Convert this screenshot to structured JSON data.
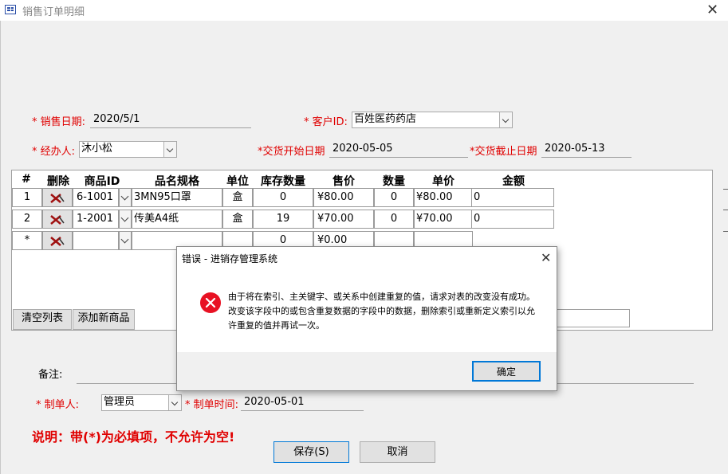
{
  "window": {
    "title": "销售订单明细"
  },
  "form": {
    "sale_date": {
      "label": "* 销售日期:",
      "value": "2020/5/1"
    },
    "customer_id": {
      "label": "* 客户ID:",
      "value": "百姓医药药店"
    },
    "handler": {
      "label": "* 经办人:",
      "value": "沐小松"
    },
    "delivery_start": {
      "label": "*交货开始日期",
      "value": "2020-05-05"
    },
    "delivery_end": {
      "label": "*交货截止日期",
      "value": "2020-05-13"
    },
    "remark": {
      "label": "备注:",
      "value": ""
    },
    "creator": {
      "label": "* 制单人:",
      "value": "管理员"
    },
    "create_time": {
      "label": "* 制单时间:",
      "value": "2020-05-01"
    }
  },
  "grid": {
    "columns": [
      "#",
      "删除",
      "商品ID",
      "品名规格",
      "单位",
      "库存数量",
      "售价",
      "数量",
      "单价",
      "金额"
    ],
    "rows": [
      {
        "num": "1",
        "product_id": "6-1001",
        "name": "3MN95口罩",
        "unit": "盒",
        "stock": "0",
        "price": "¥80.00",
        "qty": "0",
        "unit_price": "¥80.00",
        "amount": "0"
      },
      {
        "num": "2",
        "product_id": "1-2001",
        "name": "传美A4纸",
        "unit": "盒",
        "stock": "19",
        "price": "¥70.00",
        "qty": "0",
        "unit_price": "¥70.00",
        "amount": "0"
      },
      {
        "num": "*",
        "product_id": "",
        "name": "",
        "unit": "",
        "stock": "0",
        "price": "¥0.00",
        "qty": "",
        "unit_price": "",
        "amount": ""
      }
    ],
    "clear_label": "清空列表",
    "add_label": "添加新商品"
  },
  "note": "说明：带(*)为必填项，不允许为空!",
  "buttons": {
    "save": "保存(S)",
    "cancel": "取消"
  },
  "dialog": {
    "title": "错误 - 进销存管理系统",
    "message": "由于将在索引、主关键字、或关系中创建重复的值，请求对表的改变没有成功。改变该字段中的或包含重复数据的字段中的数据，删除索引或重新定义索引以允许重复的值并再试一次。",
    "ok_label": "确定"
  },
  "colors": {
    "required_label": "#e00000",
    "dialog_error_icon": "#e81123",
    "focus_border": "#0078d7"
  }
}
